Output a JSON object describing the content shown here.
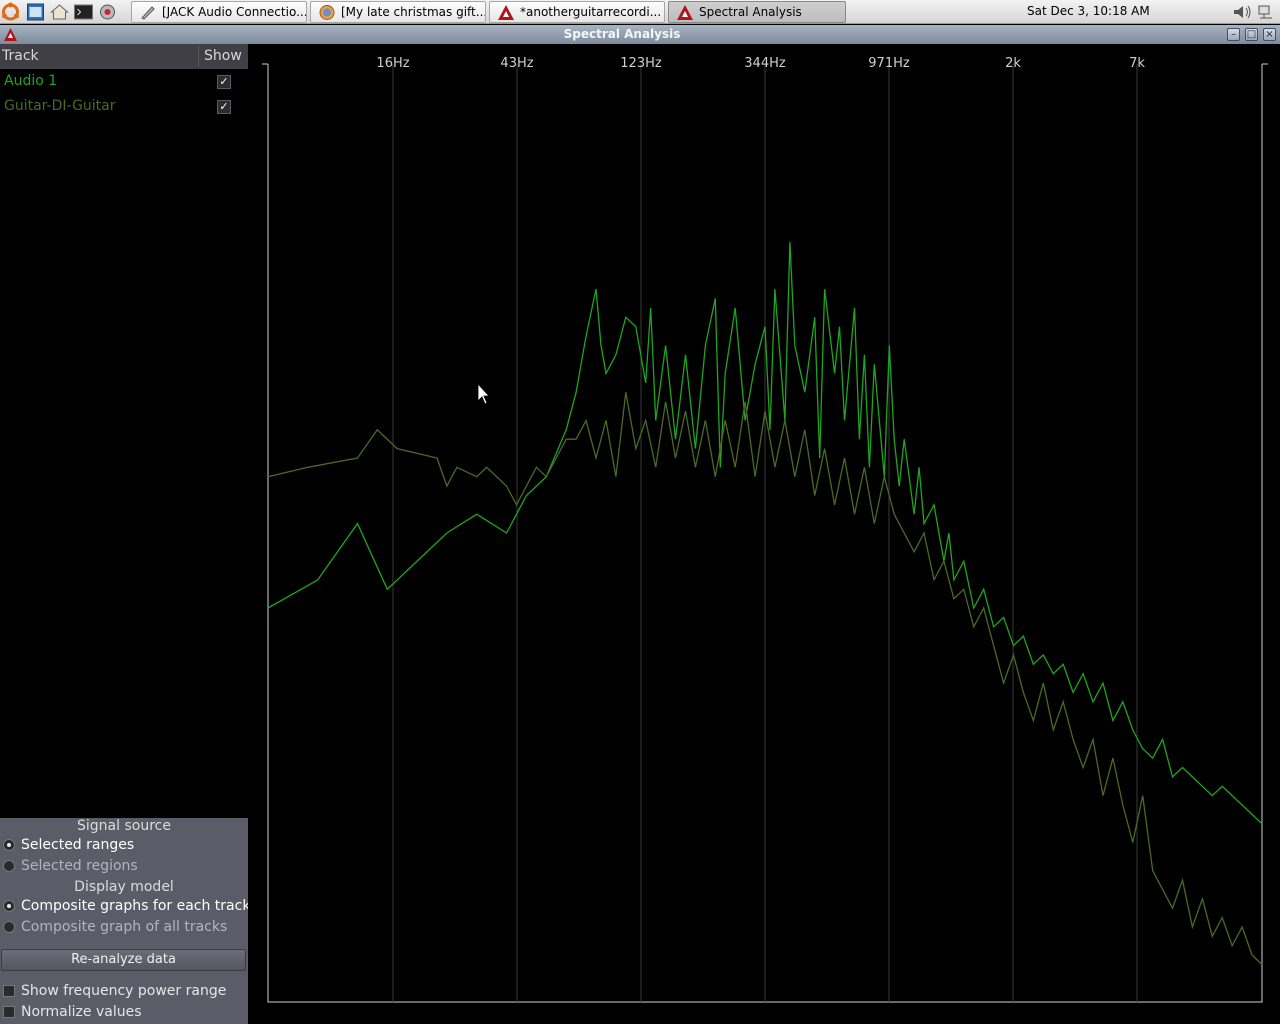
{
  "taskbar": {
    "tasks": [
      {
        "label": "[JACK Audio Connectio..."
      },
      {
        "label": "[My late christmas gift..."
      },
      {
        "label": "*anotherguitarrecordi..."
      },
      {
        "label": "Spectral Analysis"
      }
    ],
    "clock": "Sat Dec  3, 10:18 AM"
  },
  "window": {
    "title": "Spectral Analysis"
  },
  "tracks": {
    "header": {
      "track": "Track",
      "show": "Show"
    },
    "items": [
      {
        "name": "Audio 1",
        "show": true,
        "color": "#1fa51f"
      },
      {
        "name": "Guitar-DI-Guitar",
        "show": true,
        "color": "#4a6a28"
      }
    ]
  },
  "options": {
    "signal_source_title": "Signal source",
    "signal_sources": [
      {
        "label": "Selected ranges",
        "selected": true
      },
      {
        "label": "Selected regions",
        "selected": false
      }
    ],
    "display_model_title": "Display model",
    "display_models": [
      {
        "label": "Composite graphs for each track",
        "selected": true
      },
      {
        "label": "Composite graph of all tracks",
        "selected": false
      }
    ],
    "reanalyze_label": "Re-analyze data",
    "show_power_range_label": "Show frequency power range",
    "normalize_label": "Normalize values"
  },
  "chart_data": {
    "type": "line",
    "x_scale": "log",
    "x_ticks": [
      "16Hz",
      "43Hz",
      "123Hz",
      "344Hz",
      "971Hz",
      "2k",
      "7k"
    ],
    "grid": true,
    "series": [
      {
        "name": "Audio 1",
        "color": "#1fa51f",
        "points": [
          [
            0,
            0.58
          ],
          [
            0.05,
            0.55
          ],
          [
            0.09,
            0.49
          ],
          [
            0.12,
            0.56
          ],
          [
            0.15,
            0.53
          ],
          [
            0.18,
            0.5
          ],
          [
            0.21,
            0.48
          ],
          [
            0.24,
            0.5
          ],
          [
            0.26,
            0.46
          ],
          [
            0.28,
            0.44
          ],
          [
            0.3,
            0.39
          ],
          [
            0.31,
            0.35
          ],
          [
            0.32,
            0.29
          ],
          [
            0.33,
            0.24
          ],
          [
            0.335,
            0.3
          ],
          [
            0.34,
            0.33
          ],
          [
            0.35,
            0.31
          ],
          [
            0.36,
            0.27
          ],
          [
            0.37,
            0.28
          ],
          [
            0.38,
            0.34
          ],
          [
            0.385,
            0.26
          ],
          [
            0.39,
            0.38
          ],
          [
            0.4,
            0.3
          ],
          [
            0.41,
            0.4
          ],
          [
            0.42,
            0.31
          ],
          [
            0.43,
            0.41
          ],
          [
            0.44,
            0.3
          ],
          [
            0.45,
            0.25
          ],
          [
            0.455,
            0.43
          ],
          [
            0.46,
            0.33
          ],
          [
            0.47,
            0.26
          ],
          [
            0.48,
            0.38
          ],
          [
            0.49,
            0.32
          ],
          [
            0.5,
            0.28
          ],
          [
            0.505,
            0.39
          ],
          [
            0.51,
            0.24
          ],
          [
            0.52,
            0.38
          ],
          [
            0.525,
            0.19
          ],
          [
            0.53,
            0.3
          ],
          [
            0.54,
            0.35
          ],
          [
            0.55,
            0.27
          ],
          [
            0.555,
            0.42
          ],
          [
            0.56,
            0.24
          ],
          [
            0.57,
            0.33
          ],
          [
            0.575,
            0.28
          ],
          [
            0.58,
            0.38
          ],
          [
            0.59,
            0.26
          ],
          [
            0.595,
            0.4
          ],
          [
            0.6,
            0.31
          ],
          [
            0.605,
            0.43
          ],
          [
            0.61,
            0.32
          ],
          [
            0.62,
            0.44
          ],
          [
            0.625,
            0.3
          ],
          [
            0.63,
            0.4
          ],
          [
            0.635,
            0.45
          ],
          [
            0.64,
            0.4
          ],
          [
            0.65,
            0.48
          ],
          [
            0.655,
            0.43
          ],
          [
            0.66,
            0.49
          ],
          [
            0.67,
            0.47
          ],
          [
            0.68,
            0.53
          ],
          [
            0.685,
            0.5
          ],
          [
            0.69,
            0.55
          ],
          [
            0.7,
            0.53
          ],
          [
            0.71,
            0.58
          ],
          [
            0.72,
            0.56
          ],
          [
            0.73,
            0.6
          ],
          [
            0.74,
            0.59
          ],
          [
            0.75,
            0.62
          ],
          [
            0.76,
            0.61
          ],
          [
            0.77,
            0.64
          ],
          [
            0.78,
            0.63
          ],
          [
            0.79,
            0.65
          ],
          [
            0.8,
            0.64
          ],
          [
            0.81,
            0.67
          ],
          [
            0.82,
            0.65
          ],
          [
            0.83,
            0.68
          ],
          [
            0.84,
            0.66
          ],
          [
            0.85,
            0.7
          ],
          [
            0.86,
            0.68
          ],
          [
            0.87,
            0.71
          ],
          [
            0.88,
            0.73
          ],
          [
            0.89,
            0.74
          ],
          [
            0.9,
            0.72
          ],
          [
            0.91,
            0.76
          ],
          [
            0.92,
            0.75
          ],
          [
            0.93,
            0.76
          ],
          [
            0.94,
            0.77
          ],
          [
            0.95,
            0.78
          ],
          [
            0.96,
            0.77
          ],
          [
            0.97,
            0.78
          ],
          [
            0.98,
            0.79
          ],
          [
            0.99,
            0.8
          ],
          [
            1.0,
            0.81
          ]
        ]
      },
      {
        "name": "Guitar-DI-Guitar",
        "color": "#4a6a28",
        "points": [
          [
            0,
            0.44
          ],
          [
            0.04,
            0.43
          ],
          [
            0.09,
            0.42
          ],
          [
            0.11,
            0.39
          ],
          [
            0.13,
            0.41
          ],
          [
            0.17,
            0.42
          ],
          [
            0.18,
            0.45
          ],
          [
            0.19,
            0.43
          ],
          [
            0.21,
            0.44
          ],
          [
            0.22,
            0.43
          ],
          [
            0.24,
            0.45
          ],
          [
            0.25,
            0.47
          ],
          [
            0.26,
            0.45
          ],
          [
            0.27,
            0.43
          ],
          [
            0.28,
            0.44
          ],
          [
            0.29,
            0.42
          ],
          [
            0.3,
            0.4
          ],
          [
            0.31,
            0.4
          ],
          [
            0.32,
            0.38
          ],
          [
            0.33,
            0.42
          ],
          [
            0.34,
            0.38
          ],
          [
            0.35,
            0.44
          ],
          [
            0.36,
            0.35
          ],
          [
            0.37,
            0.41
          ],
          [
            0.38,
            0.38
          ],
          [
            0.39,
            0.43
          ],
          [
            0.4,
            0.36
          ],
          [
            0.41,
            0.42
          ],
          [
            0.42,
            0.37
          ],
          [
            0.43,
            0.43
          ],
          [
            0.44,
            0.38
          ],
          [
            0.45,
            0.44
          ],
          [
            0.46,
            0.38
          ],
          [
            0.47,
            0.43
          ],
          [
            0.48,
            0.36
          ],
          [
            0.49,
            0.44
          ],
          [
            0.5,
            0.37
          ],
          [
            0.51,
            0.43
          ],
          [
            0.52,
            0.38
          ],
          [
            0.53,
            0.44
          ],
          [
            0.54,
            0.39
          ],
          [
            0.55,
            0.46
          ],
          [
            0.56,
            0.41
          ],
          [
            0.57,
            0.47
          ],
          [
            0.58,
            0.42
          ],
          [
            0.59,
            0.48
          ],
          [
            0.6,
            0.43
          ],
          [
            0.61,
            0.49
          ],
          [
            0.62,
            0.44
          ],
          [
            0.63,
            0.48
          ],
          [
            0.64,
            0.5
          ],
          [
            0.65,
            0.52
          ],
          [
            0.66,
            0.5
          ],
          [
            0.67,
            0.55
          ],
          [
            0.68,
            0.53
          ],
          [
            0.69,
            0.57
          ],
          [
            0.7,
            0.56
          ],
          [
            0.71,
            0.6
          ],
          [
            0.72,
            0.58
          ],
          [
            0.73,
            0.62
          ],
          [
            0.74,
            0.66
          ],
          [
            0.75,
            0.63
          ],
          [
            0.76,
            0.67
          ],
          [
            0.77,
            0.7
          ],
          [
            0.78,
            0.66
          ],
          [
            0.79,
            0.71
          ],
          [
            0.8,
            0.68
          ],
          [
            0.81,
            0.72
          ],
          [
            0.82,
            0.75
          ],
          [
            0.83,
            0.72
          ],
          [
            0.84,
            0.78
          ],
          [
            0.85,
            0.74
          ],
          [
            0.86,
            0.79
          ],
          [
            0.87,
            0.83
          ],
          [
            0.88,
            0.78
          ],
          [
            0.89,
            0.86
          ],
          [
            0.9,
            0.88
          ],
          [
            0.91,
            0.9
          ],
          [
            0.92,
            0.87
          ],
          [
            0.93,
            0.92
          ],
          [
            0.94,
            0.89
          ],
          [
            0.95,
            0.93
          ],
          [
            0.96,
            0.91
          ],
          [
            0.97,
            0.94
          ],
          [
            0.98,
            0.92
          ],
          [
            0.99,
            0.95
          ],
          [
            1.0,
            0.96
          ]
        ]
      }
    ]
  }
}
